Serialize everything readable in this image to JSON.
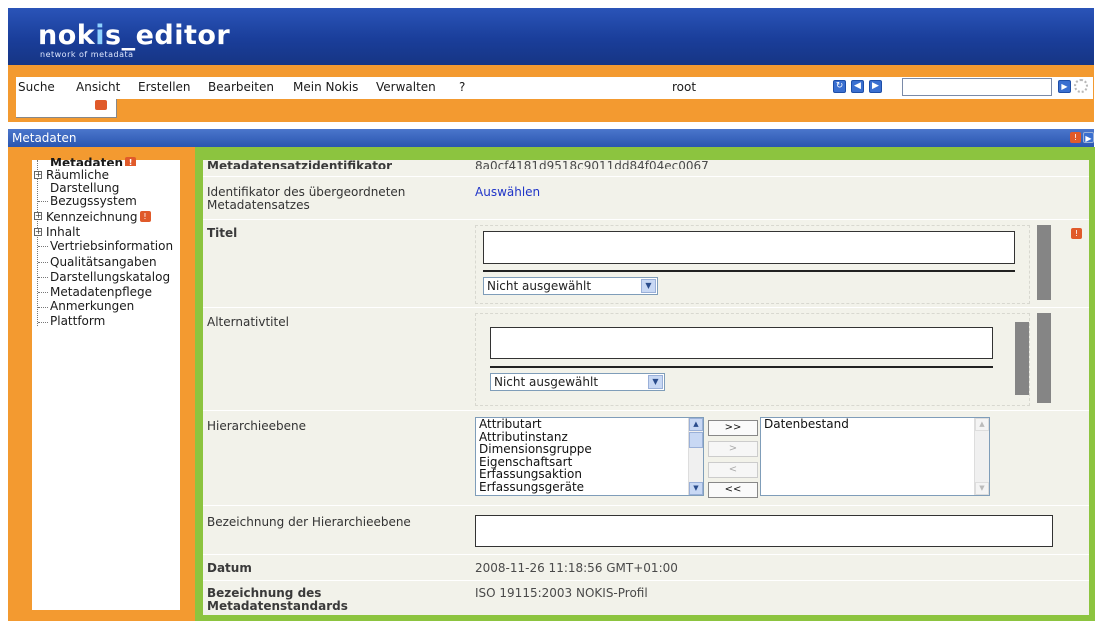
{
  "header": {
    "logo_prefix": "nok",
    "logo_dot": "i",
    "logo_suffix": "s_editor",
    "tagline": "network of metadata"
  },
  "menu": {
    "items": [
      "Suche",
      "Ansicht",
      "Erstellen",
      "Bearbeiten",
      "Mein Nokis",
      "Verwalten",
      "?"
    ],
    "user": "root",
    "search_placeholder": ""
  },
  "panel": {
    "title": "Metadaten"
  },
  "tree": {
    "items": [
      {
        "label": "Metadaten",
        "expandable": false,
        "warning": true
      },
      {
        "label": "Räumliche",
        "expandable": true,
        "warning": false
      },
      {
        "label": "Darstellung",
        "expandable": false,
        "warning": false
      },
      {
        "label": "Bezugssystem",
        "expandable": false,
        "warning": false
      },
      {
        "label": "Kennzeichnung",
        "expandable": true,
        "warning": true
      },
      {
        "label": "Inhalt",
        "expandable": true,
        "warning": false
      },
      {
        "label": "Vertriebsinformation",
        "expandable": false,
        "warning": false
      },
      {
        "label": "Qualitätsangaben",
        "expandable": false,
        "warning": false
      },
      {
        "label": "Darstellungskatalog",
        "expandable": false,
        "warning": false
      },
      {
        "label": "Metadatenpflege",
        "expandable": false,
        "warning": false
      },
      {
        "label": "Anmerkungen",
        "expandable": false,
        "warning": false
      },
      {
        "label": "Plattform",
        "expandable": false,
        "warning": false
      }
    ]
  },
  "form": {
    "identifier_label": "Metadatensatzidentifikator",
    "identifier_value": "8a0cf4181d9518c9011dd84f04ec0067",
    "parent_label_1": "Identifikator des übergeordneten",
    "parent_label_2": "Metadatensatzes",
    "parent_link": "Auswählen",
    "title_label": "Titel",
    "title_value": "",
    "title_select": "Nicht ausgewählt",
    "alt_title_label": "Alternativtitel",
    "alt_title_value": "",
    "alt_title_select": "Nicht ausgewählt",
    "hierarchy_label": "Hierarchieebene",
    "hierarchy_available": [
      "Attributart",
      "Attributinstanz",
      "Dimensionsgruppe",
      "Eigenschaftsart",
      "Erfassungsaktion",
      "Erfassungsgeräte"
    ],
    "hierarchy_selected": [
      "Datenbestand"
    ],
    "move_buttons": [
      ">>",
      ">",
      "<",
      "<<"
    ],
    "hierarchy_name_label": "Bezeichnung der Hierarchieebene",
    "hierarchy_name_value": "",
    "date_label": "Datum",
    "date_value": "2008-11-26 11:18:56 GMT+01:00",
    "standard_label_1": "Bezeichnung des",
    "standard_label_2": "Metadatenstandards",
    "standard_value": "ISO 19115:2003 NOKIS-Profil"
  }
}
